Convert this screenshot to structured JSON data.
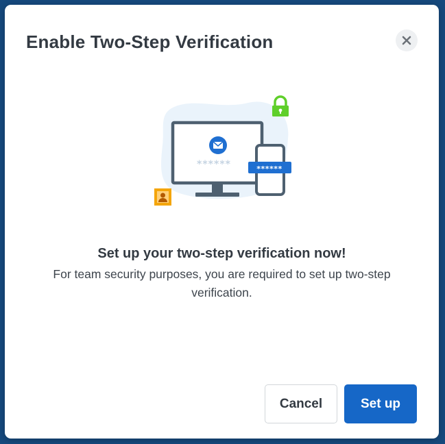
{
  "dialog": {
    "title": "Enable Two-Step Verification",
    "heading": "Set up your two-step verification now!",
    "body": "For team security purposes, you are required to set up two-step verification.",
    "buttons": {
      "cancel": "Cancel",
      "setup": "Set up"
    }
  },
  "illustration": {
    "masked_password": "******",
    "icons": [
      "lock-icon",
      "email-icon",
      "user-icon",
      "monitor-icon",
      "phone-icon"
    ],
    "colors": {
      "lock": "#5fcf2a",
      "primary": "#1f6fd1",
      "frame": "#4e6070",
      "user_card": "#f4a50b",
      "blob": "#eaf3fb"
    }
  },
  "colors": {
    "accent": "#1667c7",
    "backdrop": "#16497d"
  }
}
